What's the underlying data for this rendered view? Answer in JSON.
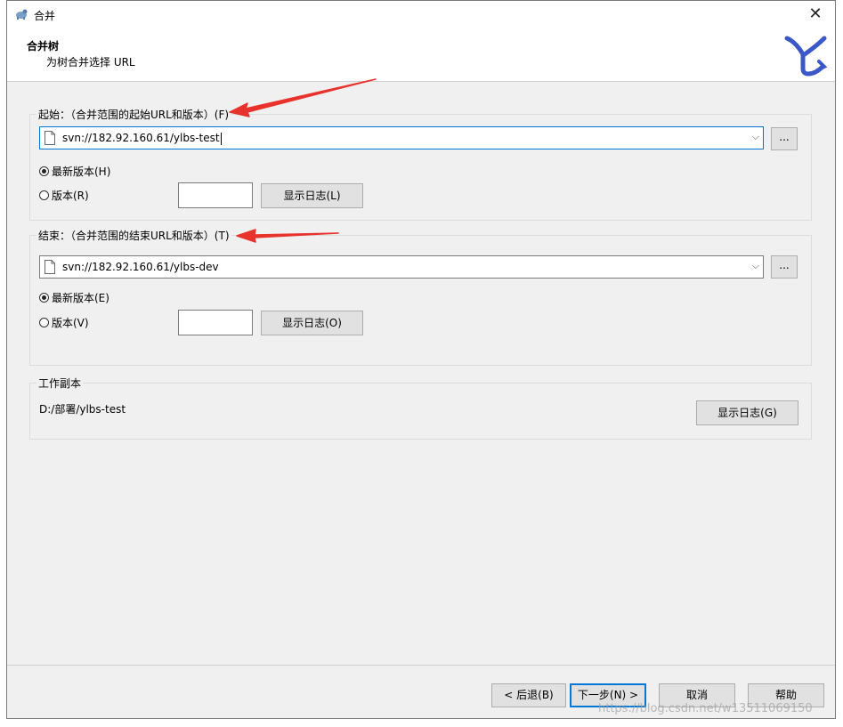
{
  "window": {
    "title": "合并",
    "close": "✕"
  },
  "header": {
    "title": "合并树",
    "subtitle": "为树合并选择 URL"
  },
  "from": {
    "legend": "起始：（合并范围的起始URL和版本）(F)",
    "url": "svn://182.92.160.61/ylbs-test",
    "browse": "...",
    "head_label": "最新版本(H)",
    "head_checked": true,
    "rev_label": "版本(R)",
    "rev_value": "",
    "show_log": "显示日志(L)"
  },
  "to": {
    "legend": "结束：（合并范围的结束URL和版本）(T)",
    "url": "svn://182.92.160.61/ylbs-dev",
    "browse": "...",
    "head_label": "最新版本(E)",
    "head_checked": true,
    "rev_label": "版本(V)",
    "rev_value": "",
    "show_log": "显示日志(O)"
  },
  "working_copy": {
    "legend": "工作副本",
    "path": "D:/部署/ylbs-test",
    "show_log": "显示日志(G)"
  },
  "footer": {
    "back": "< 后退(B)",
    "next": "下一步(N) >",
    "cancel": "取消",
    "help": "帮助"
  },
  "watermark": "https://blog.csdn.net/w13511069150",
  "colors": {
    "annotation_arrow": "#e8322c",
    "accent": "#0078d7",
    "logo": "#3a58c8"
  }
}
